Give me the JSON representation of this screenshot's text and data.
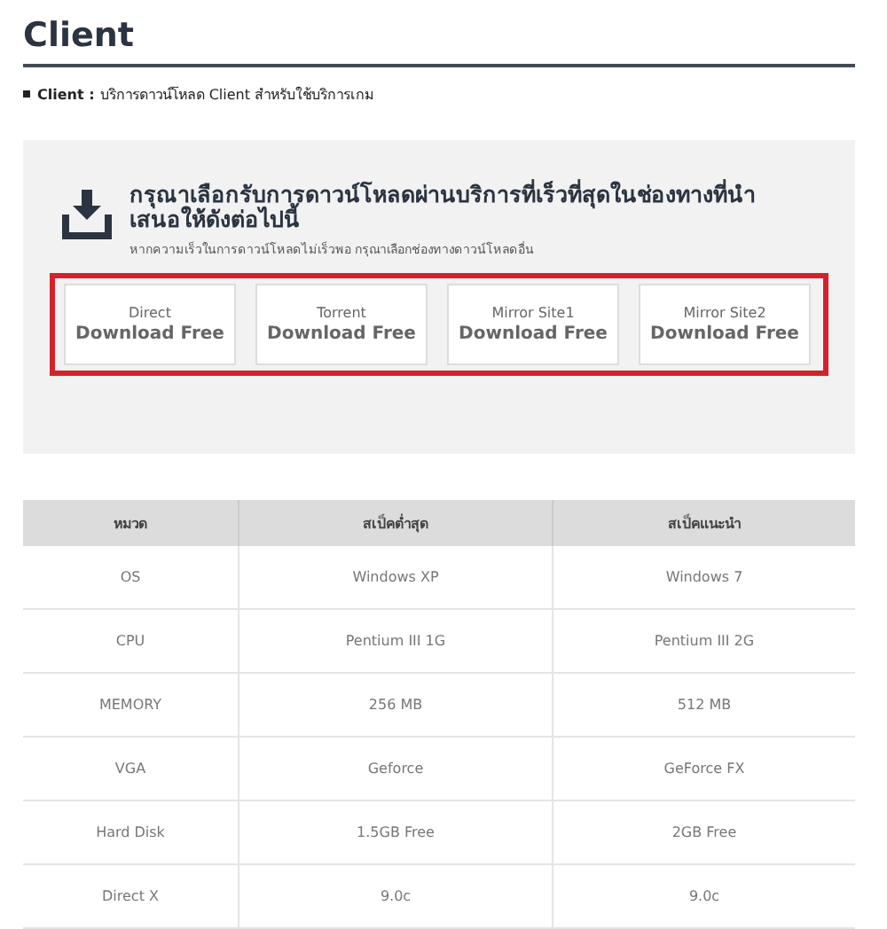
{
  "title": "Client",
  "intro": {
    "label": "Client :",
    "text": "บริการดาวน์โหลด Client สำหรับใช้บริการเกม"
  },
  "download": {
    "heading": "กรุณาเลือกรับการดาวน์โหลดผ่านบริการที่เร็วที่สุดในช่องทางที่นำเสนอให้ดังต่อไปนี้",
    "note": "หากความเร็วในการดาวน์โหลดไม่เร็วพอ กรุณาเลือกช่องทางดาวน์โหลดอื่น",
    "buttons": [
      {
        "source": "Direct",
        "label": "Download Free"
      },
      {
        "source": "Torrent",
        "label": "Download Free"
      },
      {
        "source": "Mirror Site1",
        "label": "Download Free"
      },
      {
        "source": "Mirror Site2",
        "label": "Download Free"
      }
    ]
  },
  "table": {
    "columns": [
      "หมวด",
      "สเป็คต่ำสุด",
      "สเป็คแนะนำ"
    ],
    "rows": [
      [
        "OS",
        "Windows XP",
        "Windows 7"
      ],
      [
        "CPU",
        "Pentium III 1G",
        "Pentium III 2G"
      ],
      [
        "MEMORY",
        "256 MB",
        "512 MB"
      ],
      [
        "VGA",
        "Geforce",
        "GeForce FX"
      ],
      [
        "Hard Disk",
        "1.5GB Free",
        "2GB Free"
      ],
      [
        "Direct X",
        "9.0c",
        "9.0c"
      ]
    ]
  }
}
